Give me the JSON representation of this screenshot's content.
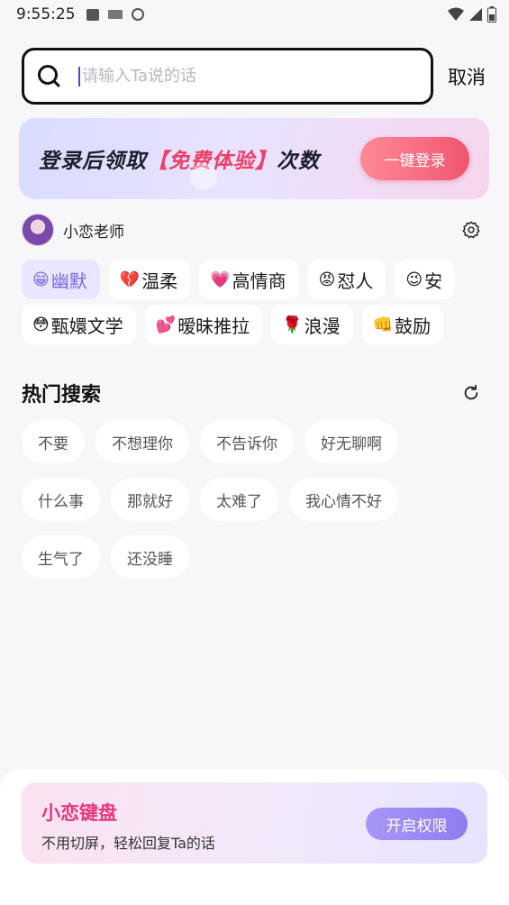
{
  "status_bar": {
    "time": "9:55:25"
  },
  "search": {
    "placeholder": "请输入Ta说的话",
    "value": "",
    "cancel_label": "取消"
  },
  "banner": {
    "text_before": "登录后领取",
    "text_highlight": "【免费体验】",
    "text_after": "次数",
    "button_label": "一键登录"
  },
  "persona": {
    "name": "小恋老师"
  },
  "styles": [
    [
      {
        "emoji": "😁",
        "label": "幽默",
        "active": true
      },
      {
        "emoji": "💔",
        "label": "温柔",
        "active": false
      },
      {
        "emoji": "💗",
        "label": "高情商",
        "active": false
      },
      {
        "emoji": "😡",
        "label": "怼人",
        "active": false
      },
      {
        "emoji": "😉",
        "label": "安",
        "active": false
      }
    ],
    [
      {
        "emoji": "😳",
        "label": "甄嬛文学",
        "active": false
      },
      {
        "emoji": "💕",
        "label": "暧昧推拉",
        "active": false
      },
      {
        "emoji": "🌹",
        "label": "浪漫",
        "active": false
      },
      {
        "emoji": "👊",
        "label": "鼓励",
        "active": false
      }
    ]
  ],
  "hot_search": {
    "title": "热门搜索",
    "tags": [
      "不要",
      "不想理你",
      "不告诉你",
      "好无聊啊",
      "什么事",
      "那就好",
      "太难了",
      "我心情不好",
      "生气了",
      "还没睡"
    ]
  },
  "keyboard_promo": {
    "title": "小恋键盘",
    "subtitle": "不用切屏，轻松回复Ta的话",
    "button_label": "开启权限"
  },
  "colors": {
    "accent_purple": "#7b68e8",
    "banner_red": "#ef3f63",
    "promo_pink": "#e8367e"
  }
}
